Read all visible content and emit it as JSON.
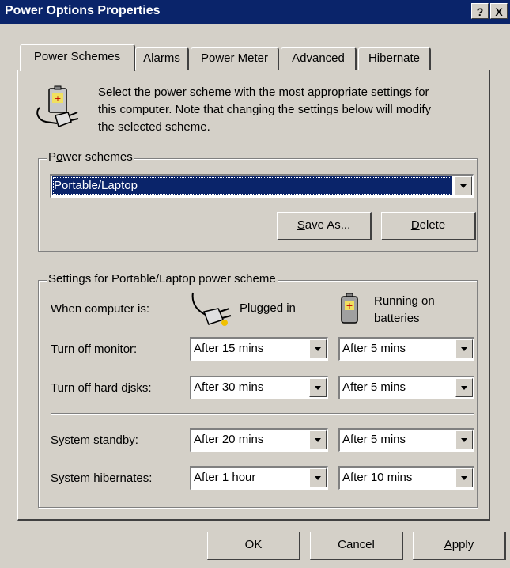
{
  "window": {
    "title": "Power Options Properties",
    "help_button": "?",
    "close_button": "X"
  },
  "tabs": [
    "Power Schemes",
    "Alarms",
    "Power Meter",
    "Advanced",
    "Hibernate"
  ],
  "intro": {
    "line1": "Select the power scheme with the most appropriate settings for",
    "line2": "this computer. Note that changing the settings below will modify",
    "line3": "the selected scheme."
  },
  "schemes_group": {
    "legend_pre": "P",
    "legend_key": "o",
    "legend_post": "wer schemes",
    "selected": "Portable/Laptop",
    "save_as_key": "S",
    "save_as_rest": "ave As...",
    "delete_key": "D",
    "delete_rest": "elete"
  },
  "settings_group": {
    "legend": "Settings for Portable/Laptop power scheme",
    "when_label": "When computer is:",
    "plugged_in": "Plugged in",
    "battery_line1": "Running on",
    "battery_line2": "batteries",
    "rows": [
      {
        "pre": "Turn off ",
        "key": "m",
        "post": "onitor:",
        "plugged": "After 15 mins",
        "battery": "After 5 mins"
      },
      {
        "pre": "Turn off hard d",
        "key": "i",
        "post": "sks:",
        "plugged": "After 30 mins",
        "battery": "After 5 mins"
      },
      {
        "pre": "System s",
        "key": "t",
        "post": "andby:",
        "plugged": "After 20 mins",
        "battery": "After 5 mins"
      },
      {
        "pre": "System ",
        "key": "h",
        "post": "ibernates:",
        "plugged": "After 1 hour",
        "battery": "After 10 mins"
      }
    ]
  },
  "footer": {
    "ok": "OK",
    "cancel": "Cancel",
    "apply_key": "A",
    "apply_rest": "pply"
  }
}
